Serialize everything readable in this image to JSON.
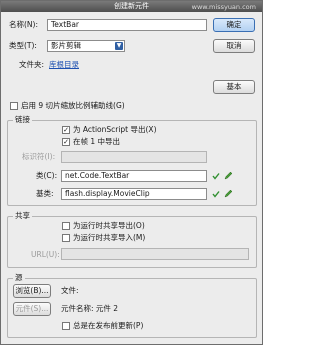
{
  "title": "创建新元件",
  "watermark": "www.missyuan.com",
  "name_label": "名称(N):",
  "name_value": "TextBar",
  "type_label": "类型(T):",
  "type_value": "影片剪辑",
  "folder_label": "文件夹:",
  "folder_value": "库根目录",
  "ok_label": "确定",
  "cancel_label": "取消",
  "basic_label": "基本",
  "guides_label": "启用 9 切片缩放比例辅助线(G)",
  "linkage": {
    "title": "链接",
    "export_as_label": "为 ActionScript 导出(X)",
    "export_as_checked": true,
    "export_frame_label": "在帧 1 中导出",
    "export_frame_checked": true,
    "identifier_label": "标识符(I):",
    "identifier_value": "",
    "class_label": "类(C):",
    "class_value": "net.Code.TextBar",
    "base_class_label": "基类:",
    "base_class_value": "flash.display.MovieClip"
  },
  "sharing": {
    "title": "共享",
    "export_runtime_label": "为运行时共享导出(O)",
    "import_runtime_label": "为运行时共享导入(M)",
    "url_label": "URL(U):",
    "url_value": ""
  },
  "source": {
    "title": "源",
    "browse_label": "浏览(B)...",
    "file_label": "文件:",
    "symbol_button_label": "元件(S)...",
    "symbol_name_label": "元件名称: 元件 2",
    "always_update_label": "总是在发布前更新(P)"
  },
  "colors": {
    "titlebar": "#5e5e5e",
    "accent_button": "#b3d1f2",
    "pencil_green": "#4a9b3a",
    "check_green": "#2f8f2f"
  }
}
